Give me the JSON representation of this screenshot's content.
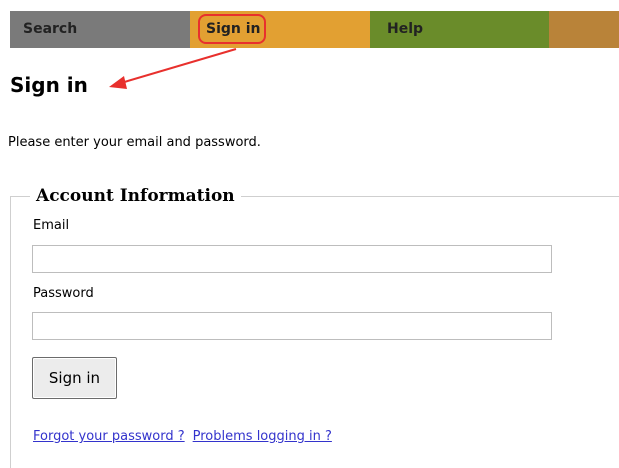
{
  "nav": {
    "tabs": [
      {
        "label": "Search"
      },
      {
        "label": "Sign in"
      },
      {
        "label": "Help"
      },
      {
        "label": ""
      }
    ]
  },
  "page": {
    "title": "Sign in",
    "intro": "Please enter your email and password."
  },
  "form": {
    "legend": "Account Information",
    "email_label": "Email",
    "email_value": "",
    "password_label": "Password",
    "password_value": "",
    "submit_label": "Sign in"
  },
  "links": {
    "forgot_password": "Forgot your password ?",
    "problems_logging_in": "Problems logging in ?"
  },
  "colors": {
    "tab_search": "#7a7a7a",
    "tab_signin": "#e2a032",
    "tab_help": "#6a8c2a",
    "tab_extra": "#b98339",
    "annotation": "#e8302d",
    "link": "#3333cc"
  }
}
